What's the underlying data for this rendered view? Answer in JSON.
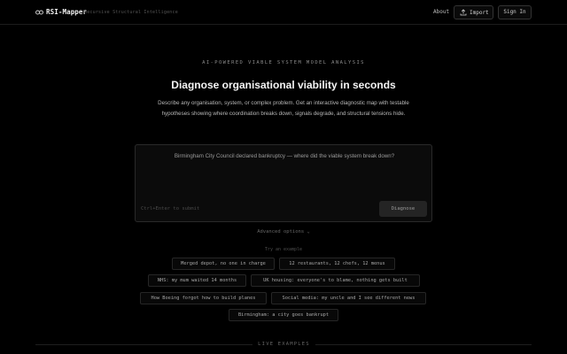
{
  "header": {
    "brand": "RSI-Mapper",
    "tagline": "Recursive Structural Intelligence",
    "nav": {
      "about": "About",
      "import": "Import",
      "sign_in": "Sign In"
    },
    "icons": {
      "logo": "infinity-logo-icon",
      "import": "upload-icon"
    }
  },
  "hero": {
    "eyebrow": "AI-POWERED VIABLE SYSTEM MODEL ANALYSIS",
    "title": "Diagnose organisational viability in seconds",
    "description": "Describe any organisation, system, or complex problem. Get an interactive diagnostic map with testable hypotheses showing where coordination breaks down, signals degrade, and structural tensions hide."
  },
  "query": {
    "placeholder": "Birmingham City Council declared bankruptcy — where did the viable system break down?",
    "hint": "Ctrl+Enter to submit",
    "submit_label": "Diagnose"
  },
  "advanced_label": "Advanced options ⌄",
  "examples": {
    "label": "Try an example",
    "items": [
      "Merged depot, no one in charge",
      "12 restaurants, 12 chefs, 12 menus",
      "NHS: my mum waited 14 months",
      "UK housing: everyone's to blame, nothing gets built",
      "How Boeing forgot how to build planes",
      "Social media: my uncle and I see different news",
      "Birmingham: a city goes bankrupt"
    ]
  },
  "live_examples_label": "LIVE EXAMPLES",
  "colors": {
    "background": "#000000",
    "text": "#e8e8e8",
    "muted": "#8a8a8a",
    "border": "#2a2a2a"
  }
}
